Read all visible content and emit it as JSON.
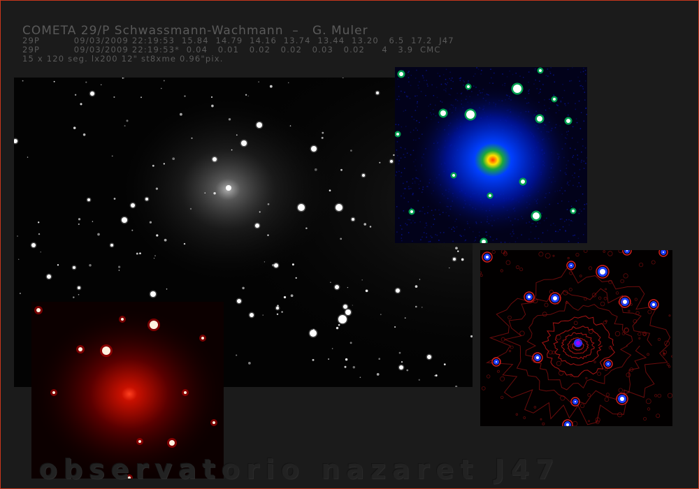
{
  "header": {
    "title": "COMETA 29/P Schwassmann-Wachmann  –   G. Muler",
    "line1": "29P          09/03/2009 22:19:53  15.84  14.79  14.16  13.74  13.44  13.20   6.5  17.2  J47",
    "line2": "29P          09/03/2009 22:19:53*  0.04   0.01   0.02   0.02   0.03   0.02     4   3.9  CMC",
    "line3": "15 x 120 seg. lx200 12\" st8xme 0.96\"pix."
  },
  "watermark": "observatorio nazaret J47",
  "colors": {
    "frame_border": "#c8371c",
    "background": "#1b1b1b",
    "header_text": "#5a5a5a",
    "blue_panel": "#0000ff",
    "red_panel": "#ff0000",
    "contour": "#c81414"
  }
}
